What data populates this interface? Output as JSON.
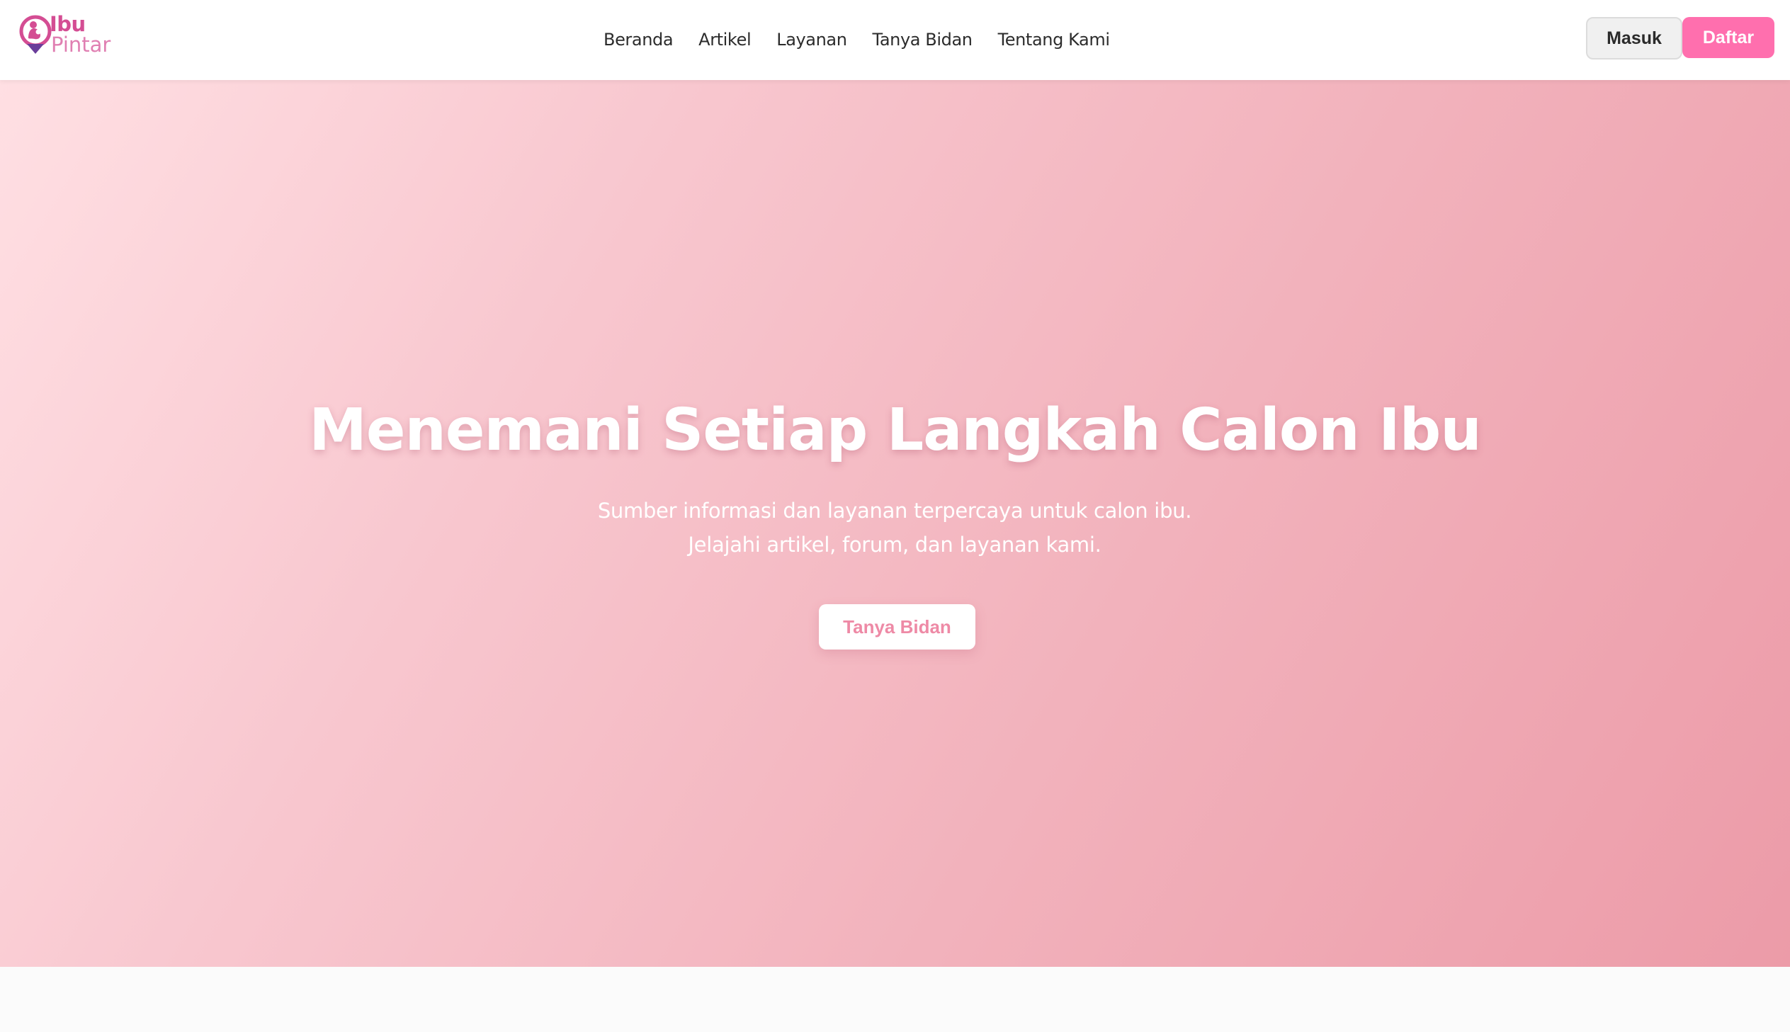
{
  "brand": {
    "name_top": "Ibu",
    "name_bottom": "Pintar",
    "icon": "mother-baby-location-pin-icon",
    "colors": {
      "primary": "#d44d93",
      "secondary": "#e07fb2",
      "pin_tip": "#6a3e9a"
    }
  },
  "nav": {
    "items": [
      {
        "label": "Beranda"
      },
      {
        "label": "Artikel"
      },
      {
        "label": "Layanan"
      },
      {
        "label": "Tanya Bidan"
      },
      {
        "label": "Tentang Kami"
      }
    ]
  },
  "auth": {
    "login_label": "Masuk",
    "register_label": "Daftar"
  },
  "hero": {
    "title": "Menemani Setiap Langkah Calon Ibu",
    "subtitle": "Sumber informasi dan layanan terpercaya untuk calon ibu. Jelajahi artikel, forum, dan layanan kami.",
    "cta_label": "Tanya Bidan",
    "gradient": [
      "#ffdfe3",
      "#f8c7cf",
      "#f2b2bc",
      "#ec9ba8"
    ]
  },
  "theme": {
    "accent": "#ff6fae",
    "cta_text": "#ee8aa6"
  }
}
